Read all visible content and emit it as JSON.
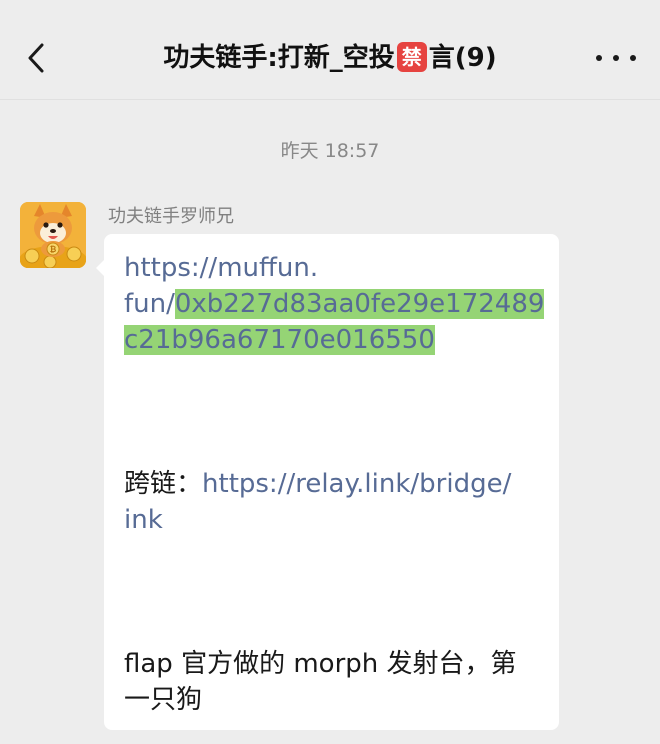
{
  "header": {
    "title_prefix": "功夫链手:打新_空投",
    "title_badge": "禁",
    "title_suffix": "言(9)"
  },
  "chat": {
    "timestamp": "昨天 18:57",
    "sender_name": "功夫链手罗师兄",
    "message": {
      "line1": "https://muffun.",
      "line2_plain": "fun/",
      "line2_highlight": "0xb227d83aa0fe29e172489",
      "line3_highlight": "c21b96a67170e016550",
      "bridge_label": "跨链：",
      "bridge_link_1": "https://relay.link/bridge/",
      "bridge_link_2": "ink",
      "note_line1": "flap 官方做的 morph 发射台，第",
      "note_line2": "一只狗"
    }
  },
  "colors": {
    "background": "#ededed",
    "bubble": "#ffffff",
    "link": "#576b95",
    "highlight": "#95d475",
    "ban_badge": "#e64340"
  },
  "icons": {
    "back": "chevron-left-icon",
    "more": "more-dots-icon",
    "avatar": "shiba-dog-coins-avatar"
  }
}
